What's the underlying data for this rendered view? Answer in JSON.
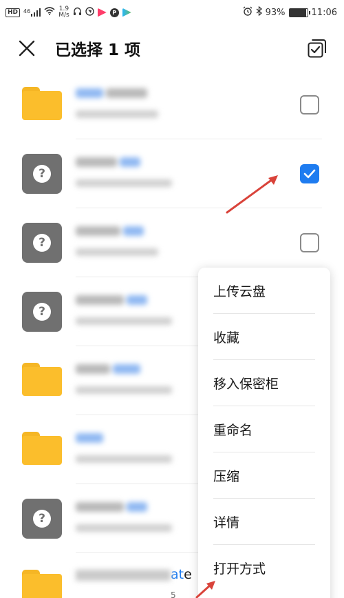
{
  "status_bar": {
    "left_badges": [
      "HD",
      "46"
    ],
    "net_speed_value": "1.9",
    "net_speed_unit": "M/s",
    "battery_percent": "93%",
    "battery_level": 0.93,
    "time": "11:06"
  },
  "header": {
    "title": "已选择 1 项"
  },
  "file_list": {
    "rows": [
      {
        "icon": "folder-icon",
        "checked": false
      },
      {
        "icon": "unknown-file-icon",
        "checked": true
      },
      {
        "icon": "unknown-file-icon",
        "checked": false
      },
      {
        "icon": "unknown-file-icon",
        "checked": null
      },
      {
        "icon": "folder-icon",
        "checked": null
      },
      {
        "icon": "folder-icon",
        "checked": null
      },
      {
        "icon": "unknown-file-icon",
        "checked": null
      },
      {
        "icon": "folder-icon",
        "checked": null
      }
    ],
    "last_row_visible_name_suffix_accent": "at",
    "last_row_visible_name_suffix": "e",
    "last_row_visible_sub": "5"
  },
  "context_menu": {
    "items": [
      {
        "label": "上传云盘"
      },
      {
        "label": "收藏"
      },
      {
        "label": "移入保密柜"
      },
      {
        "label": "重命名"
      },
      {
        "label": "压缩"
      },
      {
        "label": "详情"
      },
      {
        "label": "打开方式"
      }
    ]
  },
  "colors": {
    "accent_blue": "#1e7cf0",
    "folder_yellow": "#fbbe2c",
    "unknown_gray": "#707070",
    "annotation_arrow_red": "#d9433a"
  }
}
